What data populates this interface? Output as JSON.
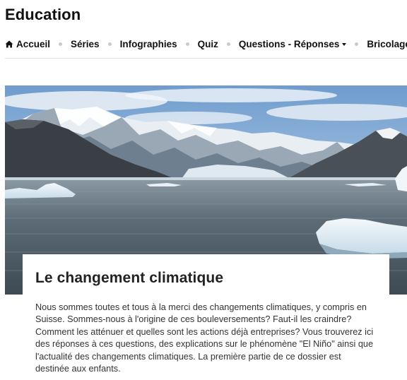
{
  "site": {
    "title": "Education"
  },
  "nav": {
    "items": [
      {
        "label": "Accueil",
        "icon": "home-icon"
      },
      {
        "label": "Séries"
      },
      {
        "label": "Infographies"
      },
      {
        "label": "Quiz"
      },
      {
        "label": "Questions - Réponses",
        "icon": "chevron-down-icon"
      },
      {
        "label": "Bricolage"
      }
    ]
  },
  "article": {
    "title": "Le changement climatique",
    "body": "Nous sommes toutes et tous à la merci des changements climatiques, y compris en Suisse. Sommes-nous à l'origine de ces bouleversements? Faut-il les craindre? Comment les atténuer et quelles sont les actions déjà entreprises? Vous trouverez ici des réponses à ces questions, des explications sur le phénomène \"El Niño\" ainsi que l'actualité des changements climatiques. La première partie de ce dossier est destinée aux enfants."
  },
  "colors": {
    "text": "#111111",
    "separator": "#c9c9c9",
    "rule": "#e3e3e3"
  }
}
